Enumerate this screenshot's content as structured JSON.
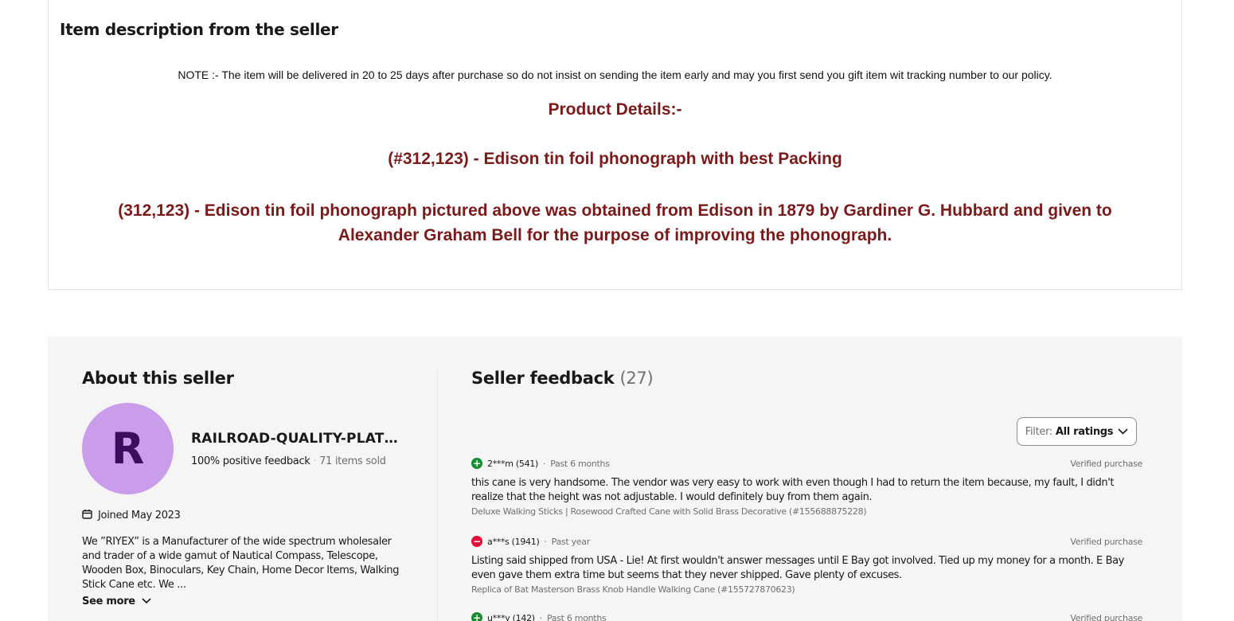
{
  "description": {
    "title": "Item description from the seller",
    "note": "NOTE :- The item will be delivered in 20 to 25 days after purchase so do not insist on sending the item early and may you first send you gift item wit tracking number to our policy.",
    "heading1": "Product Details:-",
    "heading2": "(#312,123) - Edison tin foil phonograph with best Packing",
    "heading3": "(312,123) - Edison tin foil phonograph pictured above was obtained from Edison in 1879 by Gardiner G. Hubbard and given to Alexander Graham Bell for the purpose of improving the phonograph.",
    "heading_color": "#7b1a1a"
  },
  "about": {
    "title": "About this seller",
    "avatar_letter": "R",
    "avatar_color": "#c99de9",
    "seller_name": "RAILROAD-QUALITY-PLATE...",
    "positive_feedback": "100% positive feedback",
    "items_sold": "71 items sold",
    "joined": "Joined May 2023",
    "joined_icon": "calendar-icon",
    "text": "We ”RIYEX” is a Manufacturer of the wide spectrum wholesaler and trader of a wide gamut of Nautical Compass, Telescope, Wooden Box, Binoculars, Key Chain, Home Decor Items, Walking Stick Cane etc. We ...",
    "see_more": "See more"
  },
  "feedback": {
    "title": "Seller feedback",
    "count": "(27)",
    "filter_label": "Filter:",
    "filter_value": "All ratings",
    "items": [
      {
        "type": "positive",
        "user": "2***m (541)",
        "time": "Past 6 months",
        "verified": "Verified purchase",
        "text": "this cane is very handsome. The vendor was very easy to work with even though I had to return the item because, my fault, I didn't realize that the height was not adjustable. I would definitely buy from them again.",
        "product": "Deluxe Walking Sticks | Rosewood Crafted Cane with Solid Brass Decorative (#155688875228)"
      },
      {
        "type": "negative",
        "user": "a***s (1941)",
        "time": "Past year",
        "verified": "Verified purchase",
        "text": "Listing said shipped from USA - Lie! At first wouldn't answer messages until E Bay got involved. Tied up my money for a month. E Bay even gave them extra time but seems that they never shipped. Gave plenty of excuses.",
        "product": "Replica of Bat Masterson Brass Knob Handle Walking Cane (#155727870623)"
      },
      {
        "type": "positive",
        "user": "u***y (142)",
        "time": "Past 6 months",
        "verified": "Verified purchase",
        "text": "",
        "product": ""
      }
    ]
  }
}
